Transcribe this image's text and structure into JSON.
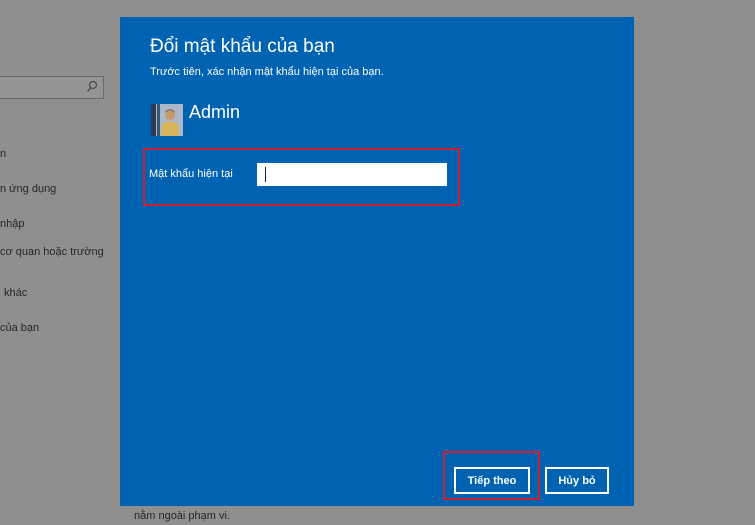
{
  "background": {
    "nav_items": [
      "n",
      "n ứng dụng",
      "nhập",
      "cơ quan hoặc trường",
      "khác",
      "của bạn"
    ],
    "footer_text": "nằm ngoài phạm vi."
  },
  "dialog": {
    "title": "Đổi mật khẩu của bạn",
    "subtitle": "Trước tiên, xác nhận mật khẩu hiện tại của bạn.",
    "username": "Admin",
    "password_label": "Mật khẩu hiện tại",
    "password_value": "",
    "next_button": "Tiếp theo",
    "cancel_button": "Hủy bỏ"
  },
  "colors": {
    "dialog_bg": "#0063b1",
    "highlight": "#d0202e",
    "overlay": "#8f8f8f"
  }
}
